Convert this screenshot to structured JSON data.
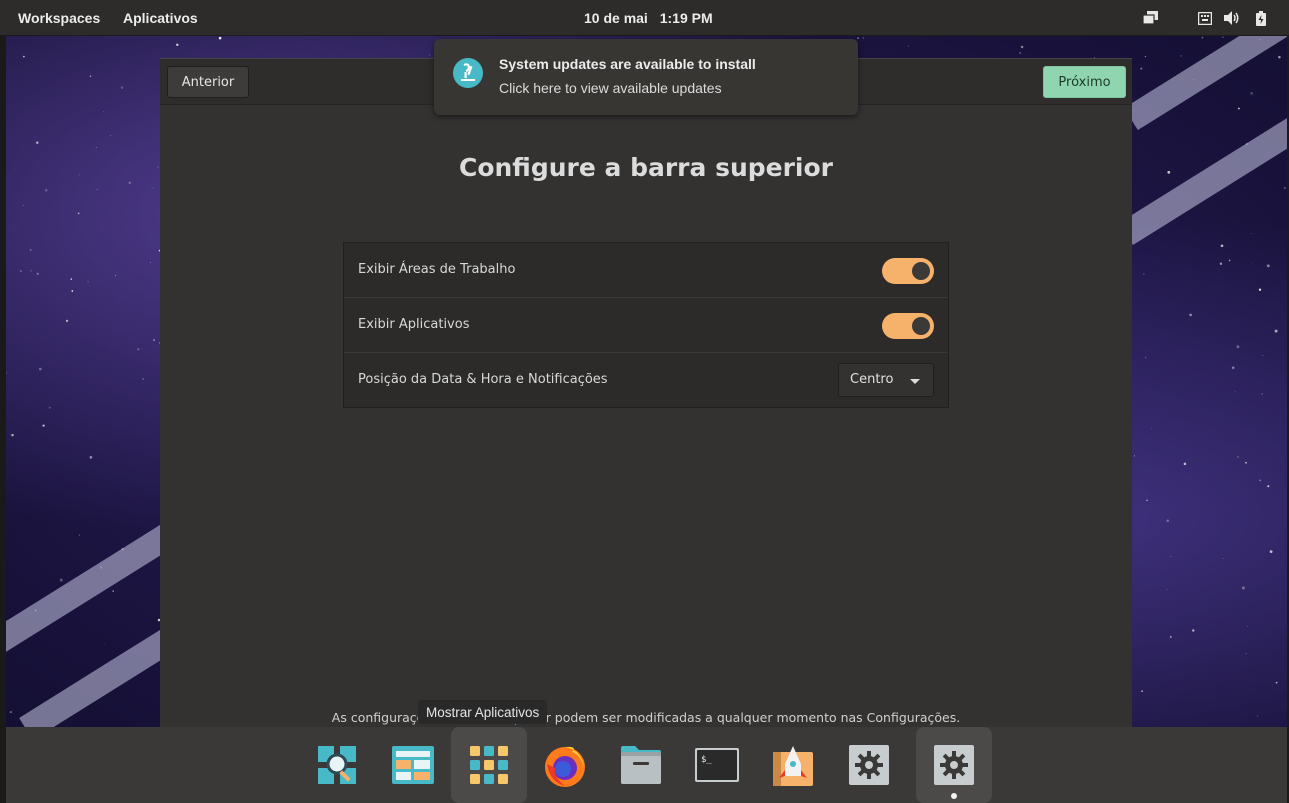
{
  "topbar": {
    "workspaces": "Workspaces",
    "applications": "Aplicativos",
    "date": "10 de mai",
    "time": "1:19 PM",
    "tray_icons": [
      "network-icon",
      "keyboard-icon",
      "volume-icon",
      "battery-icon"
    ]
  },
  "notification": {
    "title": "System updates are available to install",
    "body": "Click here to view available updates",
    "icon": "pop-shop-icon"
  },
  "window": {
    "prev_label": "Anterior",
    "next_label": "Próximo",
    "title": "Configure a barra superior",
    "rows": [
      {
        "label": "Exibir Áreas de Trabalho",
        "control": "toggle",
        "on": true
      },
      {
        "label": "Exibir Aplicativos",
        "control": "toggle",
        "on": true
      },
      {
        "label": "Posição da Data & Hora e Notificações",
        "control": "dropdown",
        "value": "Centro"
      }
    ],
    "footnote": "As configurações da barra superior podem ser modificadas a qualquer momento nas Configurações."
  },
  "dock": {
    "tooltip": "Mostrar Aplicativos",
    "items": [
      "search-launcher-icon",
      "workspaces-icon",
      "applications-grid-icon",
      "firefox-icon",
      "files-icon",
      "terminal-icon",
      "pop-shop-icon",
      "settings-icon",
      "initial-setup-icon"
    ]
  },
  "colors": {
    "accent_toggle": "#f6b26b",
    "primary_button": "#8fd6b0",
    "notification_icon": "#48b9c7"
  }
}
